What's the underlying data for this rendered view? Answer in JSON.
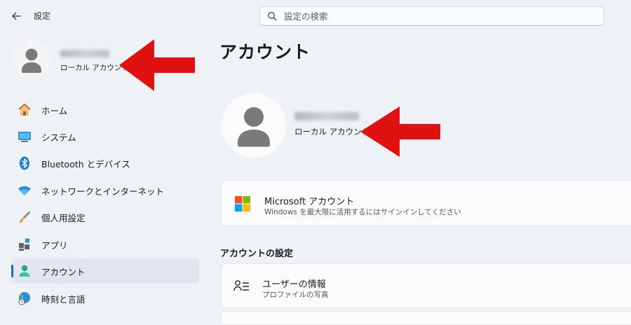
{
  "window": {
    "back_icon": "back-arrow-icon",
    "title": "設定"
  },
  "search": {
    "placeholder": "設定の検索",
    "icon": "search-icon"
  },
  "sidebar": {
    "user": {
      "name_blurred": true,
      "account_type": "ローカル アカウント"
    },
    "items": [
      {
        "label": "ホーム",
        "icon": "home-icon"
      },
      {
        "label": "システム",
        "icon": "system-monitor-icon"
      },
      {
        "label": "Bluetooth とデバイス",
        "icon": "bluetooth-icon"
      },
      {
        "label": "ネットワークとインターネット",
        "icon": "wifi-icon"
      },
      {
        "label": "個人用設定",
        "icon": "paintbrush-icon"
      },
      {
        "label": "アプリ",
        "icon": "apps-icon"
      },
      {
        "label": "アカウント",
        "icon": "account-icon",
        "active": true
      },
      {
        "label": "時刻と言語",
        "icon": "globe-clock-icon"
      }
    ]
  },
  "main": {
    "title": "アカウント",
    "profile": {
      "name_blurred": true,
      "account_type": "ローカル アカウント"
    },
    "microsoft_card": {
      "title": "Microsoft アカウント",
      "subtitle": "Windows を最大限に活用するにはサインインしてください",
      "icon": "microsoft-logo-icon"
    },
    "section_title": "アカウントの設定",
    "user_info_card": {
      "title": "ユーザーの情報",
      "subtitle": "プロファイルの写真",
      "icon": "user-info-icon"
    }
  },
  "annotations": {
    "arrow_color": "#e01111",
    "arrows": [
      "pointing-left-at-sidebar-account-type",
      "pointing-left-at-main-account-type"
    ]
  },
  "colors": {
    "background": "#eef2f7",
    "accent": "#1a67c7",
    "active_nav": "#e2e6ec"
  }
}
